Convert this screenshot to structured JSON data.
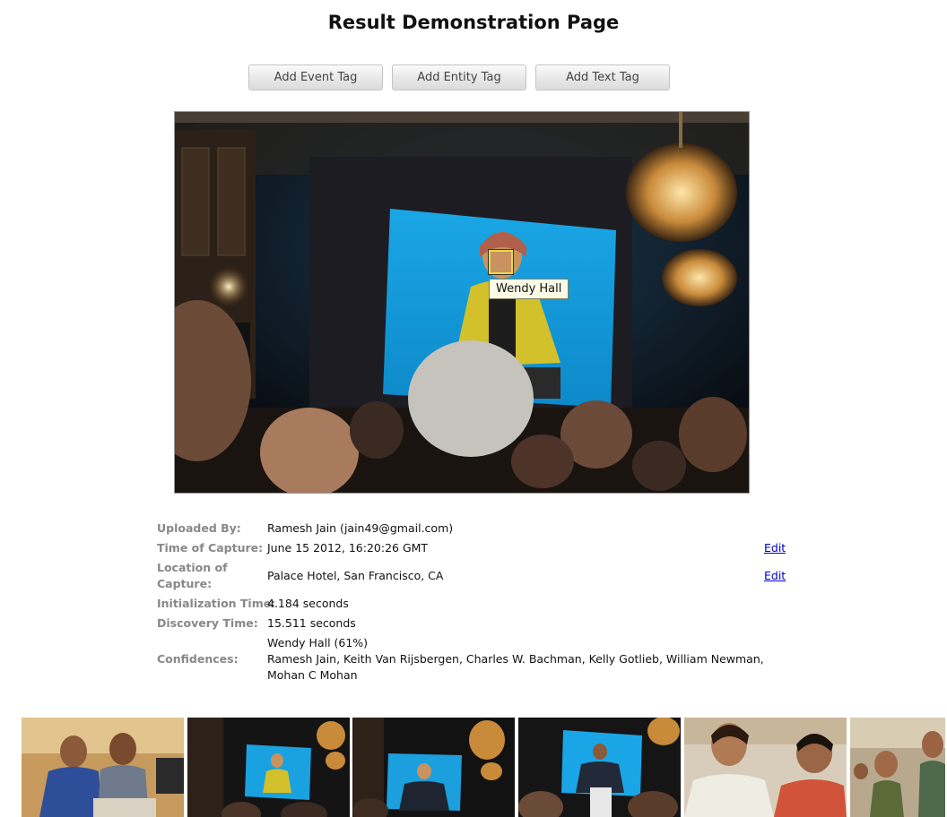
{
  "page": {
    "title": "Result Demonstration Page"
  },
  "toolbar": {
    "event_tag_label": "Add Event Tag",
    "entity_tag_label": "Add Entity Tag",
    "text_tag_label": "Add Text Tag"
  },
  "photo": {
    "face_tag": "Wendy Hall",
    "description_icon": "main-photo"
  },
  "metadata": {
    "uploaded_by_label": "Uploaded By:",
    "uploaded_by_value": "Ramesh Jain (jain49@gmail.com)",
    "time_label": "Time of Capture:",
    "time_value": "June 15 2012, 16:20:26 GMT",
    "location_label_1": "Location of",
    "location_label_2": "Capture:",
    "location_value": "Palace Hotel, San Francisco, CA",
    "init_label": "Initialization Time:",
    "init_value": "4.184 seconds",
    "discovery_label": "Discovery Time:",
    "discovery_value": "15.511 seconds",
    "confidences_label": "Confidences:",
    "confidences_line1": "Wendy Hall (61%)",
    "confidences_line2": "Ramesh Jain, Keith Van Rijsbergen, Charles W. Bachman, Kelly Gotlieb, William Newman,",
    "confidences_line3": "Mohan C Mohan",
    "edit_label": "Edit"
  },
  "colors": {
    "link": "#0000cc",
    "label_gray": "#888888",
    "face_box": "#e7d84a",
    "tag_background": "#fbfbe6"
  }
}
